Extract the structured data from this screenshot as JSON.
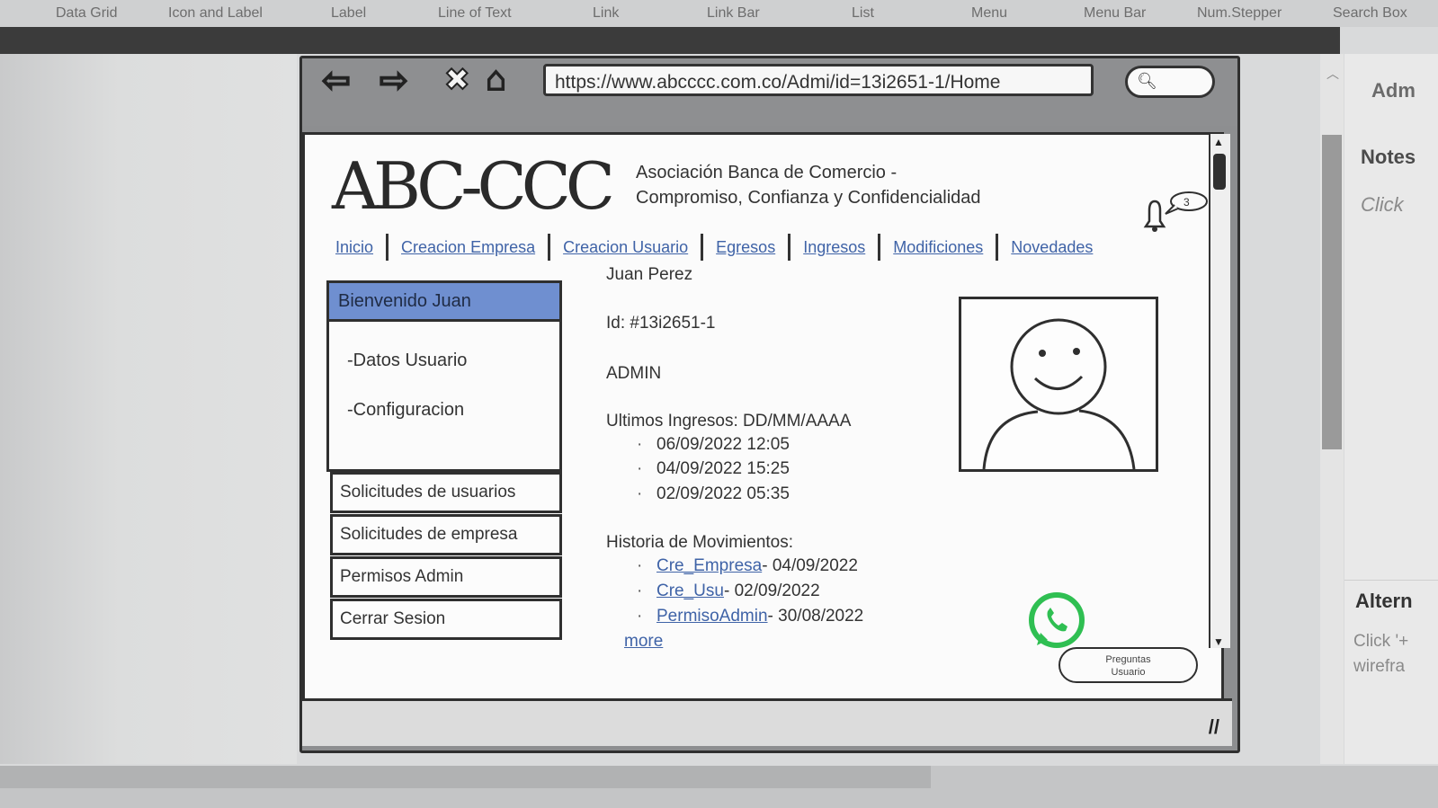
{
  "palette": {
    "items": [
      "Data Grid",
      "Icon and Label",
      "Label",
      "Line of Text",
      "Link",
      "Link Bar",
      "List",
      "Menu",
      "Menu Bar",
      "Num.Stepper",
      "Search Box"
    ]
  },
  "inspector": {
    "title": "Adm",
    "notes_label": "Notes",
    "notes_hint": "Click",
    "alternates_label": "Altern",
    "alternates_hint": "Click '+ wirefra"
  },
  "browser": {
    "url": "https://www.abcccc.com.co/Admi/id=13i2651-1/Home"
  },
  "site": {
    "logo": "ABC-CCC",
    "org_line1": "Asociación Banca de Comercio -",
    "org_line2": "Compromiso, Confianza y Confidencialidad",
    "notification_count": "3",
    "nav": [
      "Inicio",
      "Creacion Empresa",
      "Creacion Usuario",
      "Egresos",
      "Ingresos",
      "Modificiones",
      "Novedades"
    ]
  },
  "sidebar": {
    "welcome": "Bienvenido Juan",
    "submenu": [
      "-Datos Usuario",
      "-Configuracion"
    ],
    "buttons": [
      "Solicitudes de usuarios",
      "Solicitudes de empresa",
      "Permisos Admin",
      "Cerrar Sesion"
    ]
  },
  "profile": {
    "name": "Juan Perez",
    "id": "Id: #13i2651-1",
    "role": "ADMIN",
    "logins_label": "Ultimos Ingresos: DD/MM/AAAA",
    "logins": [
      "06/09/2022 12:05",
      "04/09/2022  15:25",
      "02/09/2022 05:35"
    ],
    "history_label": "Historia de Movimientos:",
    "history": [
      {
        "link": "Cre_Empresa",
        "date": "- 04/09/2022"
      },
      {
        "link": "Cre_Usu",
        "date": "- 02/09/2022"
      },
      {
        "link": "PermisoAdmin",
        "date": "- 30/08/2022"
      }
    ],
    "more": "more"
  },
  "help": {
    "faq_line1": "Preguntas",
    "faq_line2": "Usuario"
  }
}
